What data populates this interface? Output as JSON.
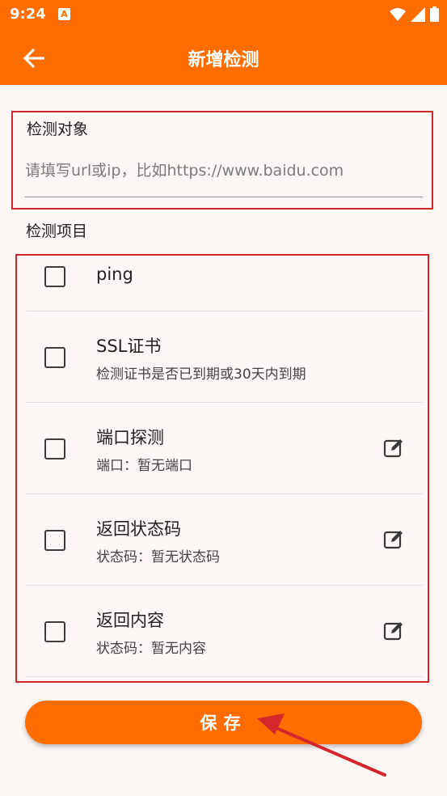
{
  "status_bar": {
    "time": "9:24",
    "notification_icon": "A",
    "icons": [
      "wifi-icon",
      "signal-icon",
      "battery-icon"
    ]
  },
  "app_bar": {
    "title": "新增检测",
    "back_icon": "arrow-left-icon"
  },
  "target": {
    "label": "检测对象",
    "placeholder": "请填写url或ip，比如https://www.baidu.com",
    "value": ""
  },
  "items_section": {
    "label": "检测项目",
    "items": [
      {
        "title": "ping",
        "subtitle": "",
        "checked": false,
        "editable": false
      },
      {
        "title": "SSL证书",
        "subtitle": "检测证书是否已到期或30天内到期",
        "checked": false,
        "editable": false
      },
      {
        "title": "端口探测",
        "subtitle": "端口：暂无端口",
        "checked": false,
        "editable": true
      },
      {
        "title": "返回状态码",
        "subtitle": "状态码：暂无状态码",
        "checked": false,
        "editable": true
      },
      {
        "title": "返回内容",
        "subtitle": "状态码：暂无内容",
        "checked": false,
        "editable": true
      }
    ]
  },
  "save_button": {
    "label": "保存"
  },
  "colors": {
    "primary": "#ff6d00",
    "annotation_red": "#d3262d",
    "background": "#fcf6f5"
  }
}
